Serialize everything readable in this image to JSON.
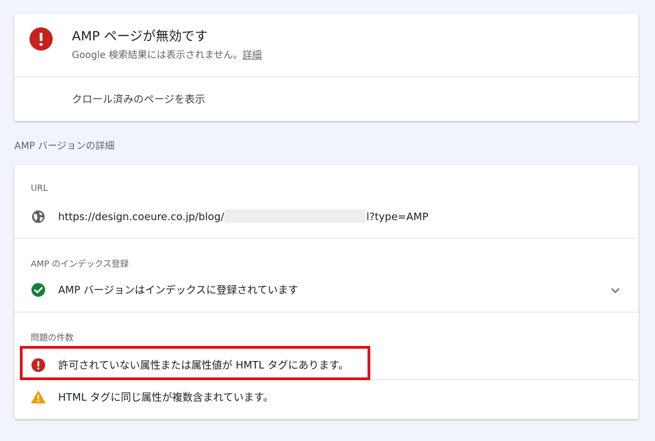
{
  "status": {
    "title": "AMP ページが無効です",
    "subtitle": "Google 検索結果には表示されません。",
    "details_link": "詳細",
    "crawled_link": "クロール済みのページを表示"
  },
  "section_title": "AMP バージョンの詳細",
  "details": {
    "url_label": "URL",
    "url_prefix": "https://design.coeure.co.jp/blog/",
    "url_suffix": "l?type=AMP",
    "index_label": "AMP のインデックス登録",
    "index_value": "AMP バージョンはインデックスに登録されています",
    "issues_label": "問題の件数",
    "issues": [
      {
        "severity": "error",
        "text": "許可されていない属性または属性値が HMTL タグにあります。"
      },
      {
        "severity": "warning",
        "text": "HTML タグに同じ属性が複数含まれています。"
      }
    ]
  },
  "colors": {
    "error": "#c5221f",
    "success": "#188038",
    "warning": "#f29900",
    "highlight": "#e0111b"
  }
}
